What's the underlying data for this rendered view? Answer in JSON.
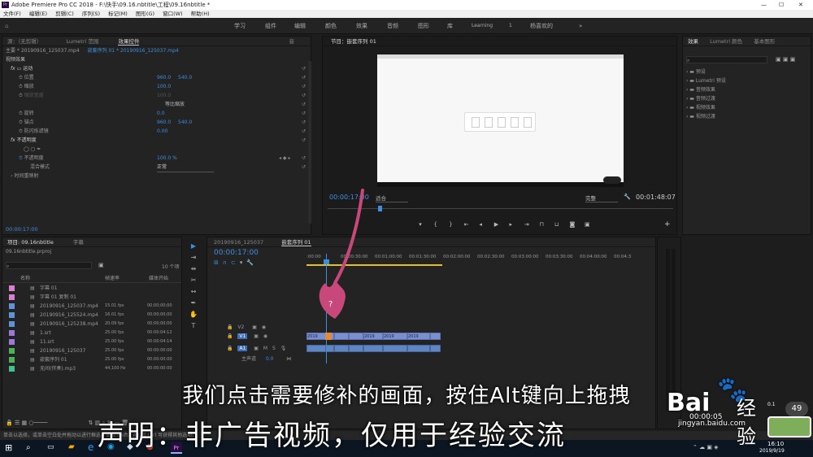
{
  "window": {
    "title": "Adobe Premiere Pro CC 2018 - F:\\快手\\09.16.nbtitle\\工程\\09.16nbtitle *",
    "controls": [
      "—",
      "☐",
      "✕"
    ]
  },
  "menu": [
    "文件(F)",
    "编辑(E)",
    "剪辑(C)",
    "序列(S)",
    "标记(M)",
    "图形(G)",
    "窗口(W)",
    "帮助(H)"
  ],
  "workspaces": [
    "学习",
    "组件",
    "编辑",
    "颜色",
    "效果",
    "音频",
    "图形",
    "库",
    "Learning",
    "1",
    "杨喜欢的",
    "»"
  ],
  "effect_controls": {
    "tabs": [
      "源：（无剪辑）",
      "Lumetri 范围",
      "效果控件",
      "音"
    ],
    "master_clip": "主要 * 20190916_125037.mp4",
    "sequence_clip": "嵌套序列 01 * 20190916_125037.mp4",
    "video_effects_label": "视频效果",
    "motion_label": "运动",
    "props": [
      {
        "name": "位置",
        "value": "960.0",
        "value2": "540.0"
      },
      {
        "name": "缩放",
        "value": "100.0",
        "value2": ""
      },
      {
        "name": "缩放宽度",
        "value": "100.0",
        "value2": ""
      },
      {
        "name": "",
        "value": "等比缩放",
        "value2": ""
      },
      {
        "name": "旋转",
        "value": "0.0",
        "value2": ""
      },
      {
        "name": "锚点",
        "value": "960.0",
        "value2": "540.0"
      },
      {
        "name": "防闪烁滤镜",
        "value": "0.00",
        "value2": ""
      }
    ],
    "opacity_label": "不透明度",
    "opacity_prop": {
      "name": "不透明度",
      "value": "100.0 %"
    },
    "blend_label": "混合模式",
    "blend_value": "正常",
    "time_remap": "时间重映射",
    "timecode": "00:00:17:00"
  },
  "program_monitor": {
    "title": "节目：嵌套序列 01",
    "timecode_left": "00:00:17:00",
    "fit": "适合",
    "quality": "完整",
    "timecode_right": "00:01:48:07"
  },
  "effects_panel": {
    "tabs": [
      "效果",
      "Lumetri 颜色",
      "基本图形"
    ],
    "items": [
      "预设",
      "Lumetri 预设",
      "音频效果",
      "音频过渡",
      "视频效果",
      "视频过渡"
    ]
  },
  "project": {
    "tabs": [
      "项目: 09.16nbtitle",
      "字幕"
    ],
    "file": "09.16nbtitle.prproj",
    "count": "10 个项",
    "columns": [
      "名称",
      "帧速率",
      "媒体开始"
    ],
    "rows": [
      {
        "name": "字幕 01",
        "fps": "",
        "start": "",
        "color": "#d77fd0"
      },
      {
        "name": "字幕 01 复制 01",
        "fps": "",
        "start": "",
        "color": "#d77fd0"
      },
      {
        "name": "20190916_125037.mp4",
        "fps": "15.01 fps",
        "start": "00;00;00;00",
        "color": "#5f93d8"
      },
      {
        "name": "20190916_125524.mp4",
        "fps": "16.01 fps",
        "start": "00;00;00;00",
        "color": "#5f93d8"
      },
      {
        "name": "20190916_125238.mp4",
        "fps": "20.09 fps",
        "start": "00;00;00;00",
        "color": "#5f93d8"
      },
      {
        "name": "1.srt",
        "fps": "25.00 fps",
        "start": "00:00:04:12",
        "color": "#9a7ad8"
      },
      {
        "name": "11.srt",
        "fps": "25.00 fps",
        "start": "00:00:04:14",
        "color": "#9a7ad8"
      },
      {
        "name": "20190916_125037",
        "fps": "25.00 fps",
        "start": "00:00:00:00",
        "color": "#4cb25a"
      },
      {
        "name": "嵌套序列 01",
        "fps": "25.00 fps",
        "start": "00:00:00:00",
        "color": "#4cb25a"
      },
      {
        "name": "无间(伴奏).mp3",
        "fps": "44,100 Hz",
        "start": "00:00:00:00",
        "color": "#3ec28f"
      }
    ]
  },
  "timeline": {
    "tabs": [
      "20190916_125037",
      "嵌套序列 01"
    ],
    "timecode": "00:00:17:00",
    "ruler": [
      ":00:00",
      "00:00:30:00",
      "00:01:00:00",
      "00:01:30:00",
      "00:02:00:00",
      "00:02:30:00",
      "00:03:00:00",
      "00:03:30:00",
      "00:04:00:00",
      "00:04:3"
    ],
    "tracks": {
      "v2": "V2",
      "v1": "V1",
      "a1": "A1",
      "master": "主声道",
      "master_val": "0.0"
    },
    "clip_label": "2019"
  },
  "status_bar": "单击以选择，或单击空白处并拖动以进行框选。使用 Shift、Alt 和 Ctrl 可获得其他选项。",
  "captions": {
    "line1": "我们点击需要修补的画面，按住Alt键向上拖拽",
    "line2": "声明：非广告视频，仅用于经验交流"
  },
  "watermark": {
    "brand": "Bai",
    "suffix": "经验",
    "url": "jingyan.baidu.com"
  },
  "taskbar": {
    "time": "16:10",
    "date": "2019/9/19",
    "mini_time": "00:00:05",
    "speed": "0.1"
  },
  "colors": {
    "accent": "#3e8ee0",
    "arrow": "#c9487b",
    "clip": "#7a8fd0"
  }
}
